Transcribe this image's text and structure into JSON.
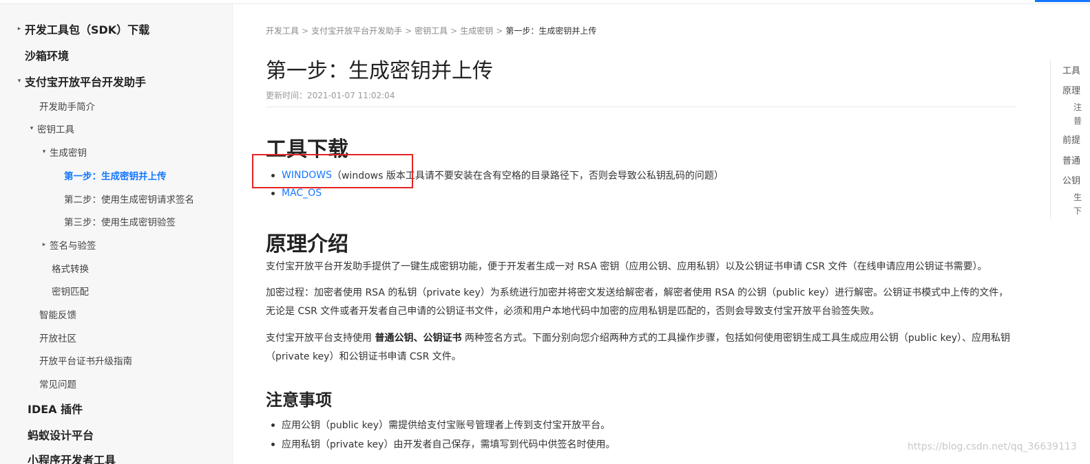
{
  "sidebar": {
    "items": [
      {
        "label": "开发工具包（SDK）下载",
        "caret": "▸"
      },
      {
        "label": "沙箱环境",
        "caret": ""
      },
      {
        "label": "支付宝开放平台开发助手",
        "caret": "▾"
      },
      {
        "label": "开发助手简介",
        "caret": ""
      },
      {
        "label": "密钥工具",
        "caret": "▾"
      },
      {
        "label": "生成密钥",
        "caret": "▾"
      },
      {
        "label": "第一步：生成密钥并上传",
        "caret": ""
      },
      {
        "label": "第二步：使用生成密钥请求签名",
        "caret": ""
      },
      {
        "label": "第三步：使用生成密钥验签",
        "caret": ""
      },
      {
        "label": "签名与验签",
        "caret": "▸"
      },
      {
        "label": "格式转换",
        "caret": ""
      },
      {
        "label": "密钥匹配",
        "caret": ""
      },
      {
        "label": "智能反馈",
        "caret": ""
      },
      {
        "label": "开放社区",
        "caret": ""
      },
      {
        "label": "开放平台证书升级指南",
        "caret": ""
      },
      {
        "label": "常见问题",
        "caret": ""
      },
      {
        "label": "IDEA 插件",
        "caret": ""
      },
      {
        "label": "蚂蚁设计平台",
        "caret": ""
      },
      {
        "label": "小程序开发者工具",
        "caret": ""
      }
    ]
  },
  "breadcrumb": {
    "items": [
      "开发工具",
      "支付宝开放平台开发助手",
      "密钥工具",
      "生成密钥"
    ],
    "separator": ">",
    "current": "第一步：生成密钥并上传"
  },
  "page": {
    "title": "第一步：生成密钥并上传",
    "updated": "更新时间：2021-01-07 11:02:04"
  },
  "sections": {
    "tools": {
      "heading": "工具下载",
      "windows_link": "WINDOWS",
      "windows_note": "（windows 版本工具请不要安装在含有空格的目录路径下，否则会导致公私钥乱码的问题）",
      "mac_link": "MAC_OS"
    },
    "principle": {
      "heading": "原理介绍",
      "p1": "支付宝开放平台开发助手提供了一键生成密钥功能，便于开发者生成一对 RSA 密钥（应用公钥、应用私钥）以及公钥证书申请 CSR 文件（在线申请应用公钥证书需要）。",
      "p2": "加密过程：加密者使用 RSA 的私钥（private key）为系统进行加密并将密文发送给解密者，解密者使用 RSA 的公钥（public key）进行解密。公钥证书模式中上传的文件，无论是 CSR 文件或者开发者自己申请的公钥证书文件，必须和用户本地代码中加密的应用私钥是匹配的，否则会导致支付宝开放平台验签失败。",
      "p3_pre": "支付宝开放平台支持使用 ",
      "p3_bold": "普通公钥、公钥证书",
      "p3_post": " 两种签名方式。下面分别向您介绍两种方式的工具操作步骤，包括如何使用密钥生成工具生成应用公钥（public key）、应用私钥（private key）和公钥证书申请 CSR 文件。"
    },
    "notes": {
      "heading": "注意事项",
      "items": [
        "应用公钥（public key）需提供给支付宝账号管理者上传到支付宝开放平台。",
        "应用私钥（private key）由开发者自己保存，需填写到代码中供签名时使用。"
      ]
    }
  },
  "toc": {
    "items": [
      "工具",
      "原理",
      "注",
      "普",
      "前提",
      "普通",
      "公钥",
      "生",
      "下"
    ]
  },
  "watermark": "https://blog.csdn.net/qq_36639113",
  "colors": {
    "link": "#1677ff",
    "highlight": "#e52222",
    "sidebar_bg": "#f7f7f7"
  }
}
